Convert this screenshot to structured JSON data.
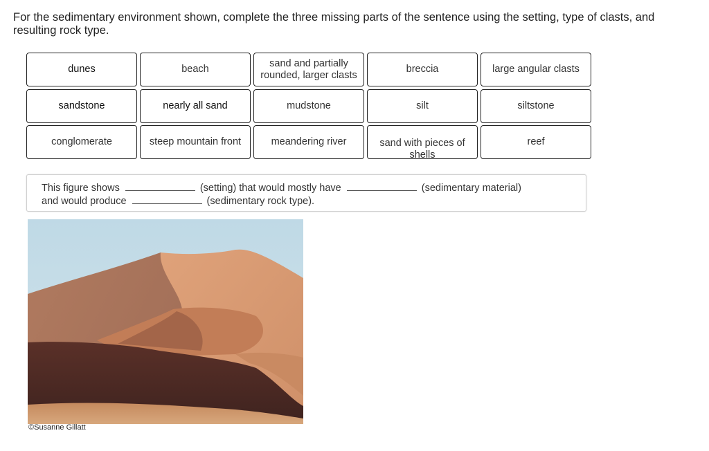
{
  "question": {
    "prompt": "For the sedimentary environment shown, complete the three missing parts of the sentence using the setting, type of clasts, and resulting rock type."
  },
  "answer_tiles": [
    {
      "label": "dunes"
    },
    {
      "label": "beach"
    },
    {
      "label": "sand and partially rounded, larger clasts"
    },
    {
      "label": "breccia"
    },
    {
      "label": "large angular clasts"
    },
    {
      "label": "sandstone"
    },
    {
      "label": "nearly all sand"
    },
    {
      "label": "mudstone"
    },
    {
      "label": "silt"
    },
    {
      "label": "siltstone"
    },
    {
      "label": "conglomerate"
    },
    {
      "label": "steep mountain front"
    },
    {
      "label": "meandering river"
    },
    {
      "label": "sand with pieces of shells"
    },
    {
      "label": "reef"
    }
  ],
  "sentence": {
    "part1": "This figure shows",
    "part2": "(setting) that would mostly have",
    "part3": "(sedimentary material)",
    "part4": "and would produce",
    "part5": "(sedimentary rock type).",
    "blanks": [
      "",
      "",
      ""
    ]
  },
  "figure": {
    "description": "sand dunes photograph",
    "credit": "©Susanne Gillatt",
    "colors": {
      "sky": "#c5dce6",
      "dune_light": "#d89a6c",
      "dune_shadow": "#8a5a45",
      "foreground_dark": "#4a2a24"
    }
  }
}
